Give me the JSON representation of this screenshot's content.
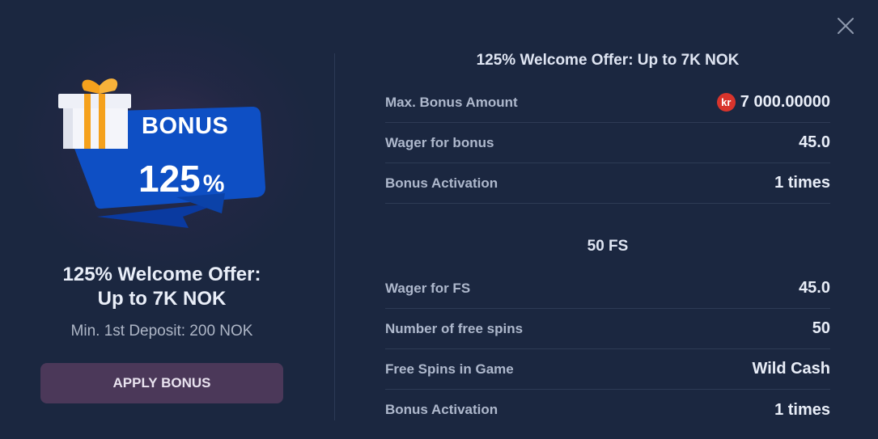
{
  "offer": {
    "banner_label": "BONUS",
    "banner_percent": "125",
    "banner_percent_sign": "%",
    "title": "125% Welcome Offer: Up to 7K NOK",
    "min_deposit": "Min. 1st Deposit: 200 NOK",
    "apply_button": "APPLY BONUS"
  },
  "bonus_section": {
    "title": "125% Welcome Offer: Up to 7K NOK",
    "currency_symbol": "kr",
    "rows": [
      {
        "label": "Max. Bonus Amount",
        "value": "7 000.00000"
      },
      {
        "label": "Wager for bonus",
        "value": "45.0"
      },
      {
        "label": "Bonus Activation",
        "value": "1 times"
      }
    ]
  },
  "fs_section": {
    "title": "50 FS",
    "rows": [
      {
        "label": "Wager for FS",
        "value": "45.0"
      },
      {
        "label": "Number of free spins",
        "value": "50"
      },
      {
        "label": "Free Spins in Game",
        "value": "Wild Cash"
      },
      {
        "label": "Bonus Activation",
        "value": "1 times"
      }
    ]
  },
  "colors": {
    "background": "#1b2740",
    "banner_blue": "#0e4fc4",
    "gift_orange": "#f5a11c",
    "button_bg": "#4b3859",
    "currency_red": "#d8342c"
  },
  "icons": [
    "close-icon",
    "gift-icon",
    "currency-kr-icon"
  ]
}
